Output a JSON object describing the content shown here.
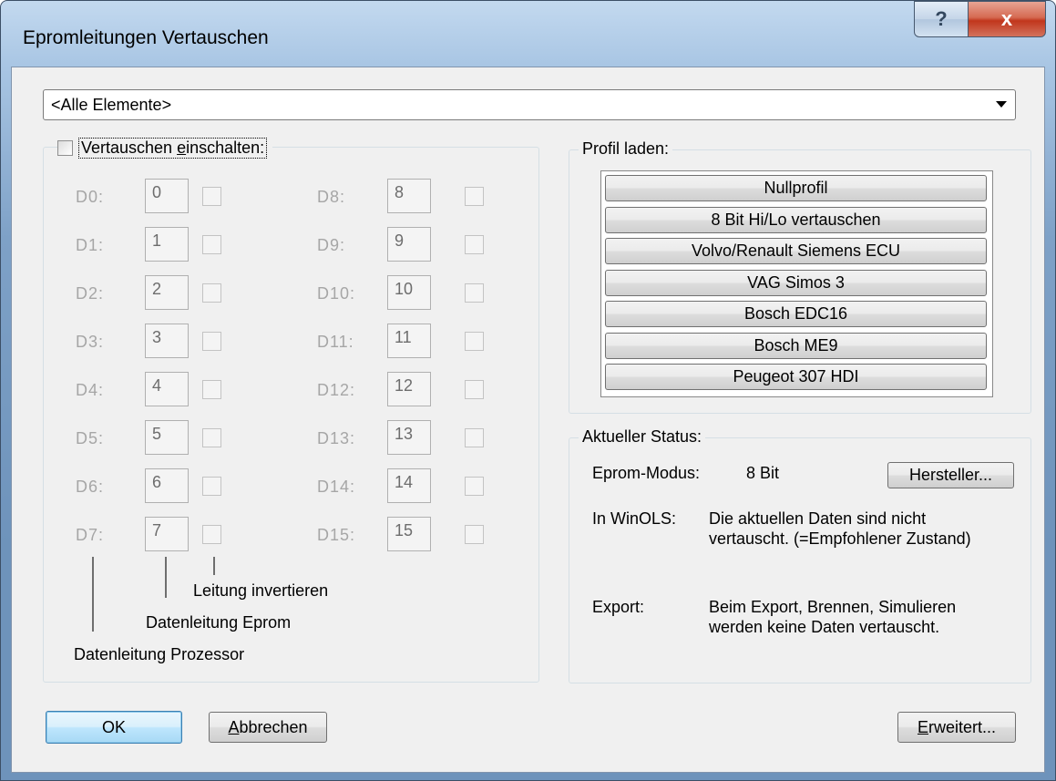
{
  "window": {
    "title": "Epromleitungen Vertauschen",
    "help_glyph": "?",
    "close_glyph": "x"
  },
  "element_select": {
    "value": "<Alle Elemente>"
  },
  "swap_group": {
    "enable_label_pre": "Vertauschen ",
    "enable_label_underlined": "e",
    "enable_label_post": "inschalten:",
    "enabled": false,
    "left_pins": [
      {
        "label": "D0:",
        "value": "0"
      },
      {
        "label": "D1:",
        "value": "1"
      },
      {
        "label": "D2:",
        "value": "2"
      },
      {
        "label": "D3:",
        "value": "3"
      },
      {
        "label": "D4:",
        "value": "4"
      },
      {
        "label": "D5:",
        "value": "5"
      },
      {
        "label": "D6:",
        "value": "6"
      },
      {
        "label": "D7:",
        "value": "7"
      }
    ],
    "right_pins": [
      {
        "label": "D8:",
        "value": "8"
      },
      {
        "label": "D9:",
        "value": "9"
      },
      {
        "label": "D10:",
        "value": "10"
      },
      {
        "label": "D11:",
        "value": "11"
      },
      {
        "label": "D12:",
        "value": "12"
      },
      {
        "label": "D13:",
        "value": "13"
      },
      {
        "label": "D14:",
        "value": "14"
      },
      {
        "label": "D15:",
        "value": "15"
      }
    ],
    "annotations": {
      "invert": "Leitung invertieren",
      "eprom_line": "Datenleitung Eprom",
      "processor_line": "Datenleitung Prozessor"
    }
  },
  "profile_group": {
    "title": "Profil laden:",
    "profiles": [
      "Nullprofil",
      "8 Bit Hi/Lo vertauschen",
      "Volvo/Renault Siemens ECU",
      "VAG Simos 3",
      "Bosch EDC16",
      "Bosch ME9",
      "Peugeot 307 HDI"
    ]
  },
  "status_group": {
    "title": "Aktueller Status:",
    "eprom_mode_label": "Eprom-Modus:",
    "eprom_mode_value": "8 Bit",
    "manufacturer_button": "Hersteller...",
    "winols_label": "In WinOLS:",
    "winols_line1": "Die aktuellen Daten sind nicht",
    "winols_line2": "vertauscht. (=Empfohlener Zustand)",
    "export_label": "Export:",
    "export_line1": "Beim Export, Brennen, Simulieren",
    "export_line2": "werden keine Daten vertauscht."
  },
  "buttons": {
    "ok": "OK",
    "cancel_underlined": "A",
    "cancel_rest": "bbrechen",
    "advanced_underlined": "E",
    "advanced_rest": "rweitert..."
  }
}
